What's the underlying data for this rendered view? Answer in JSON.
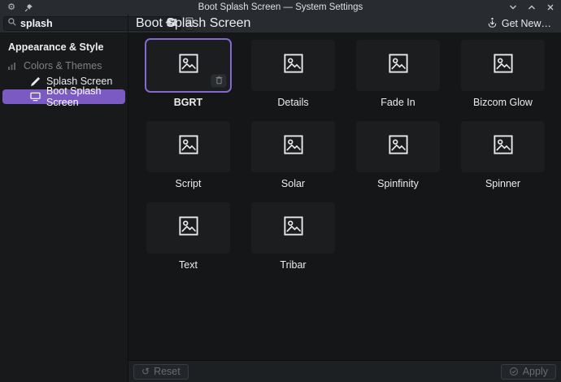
{
  "titlebar": {
    "title": "Boot Splash Screen — System Settings"
  },
  "sidebar": {
    "search_value": "splash",
    "section_header": "Appearance & Style",
    "items": [
      {
        "label": "Colors & Themes",
        "state": "disabled"
      },
      {
        "label": "Splash Screen",
        "state": "normal"
      },
      {
        "label": "Boot Splash Screen",
        "state": "selected"
      }
    ]
  },
  "header": {
    "title": "Boot Splash Screen",
    "get_new_label": "Get New…"
  },
  "themes": {
    "items": [
      {
        "label": "BGRT",
        "selected": true
      },
      {
        "label": "Details",
        "selected": false
      },
      {
        "label": "Fade In",
        "selected": false
      },
      {
        "label": "Bizcom Glow",
        "selected": false
      },
      {
        "label": "Script",
        "selected": false
      },
      {
        "label": "Solar",
        "selected": false
      },
      {
        "label": "Spinfinity",
        "selected": false
      },
      {
        "label": "Spinner",
        "selected": false
      },
      {
        "label": "Text",
        "selected": false
      },
      {
        "label": "Tribar",
        "selected": false
      }
    ]
  },
  "footer": {
    "reset_label": "Reset",
    "apply_label": "Apply"
  },
  "colors": {
    "accent_purple": "#7b5ac1",
    "selection_border": "#8668cf",
    "titlebar_bg": "#282c30",
    "content_bg": "#151617",
    "tile_bg": "#1b1d1f"
  }
}
